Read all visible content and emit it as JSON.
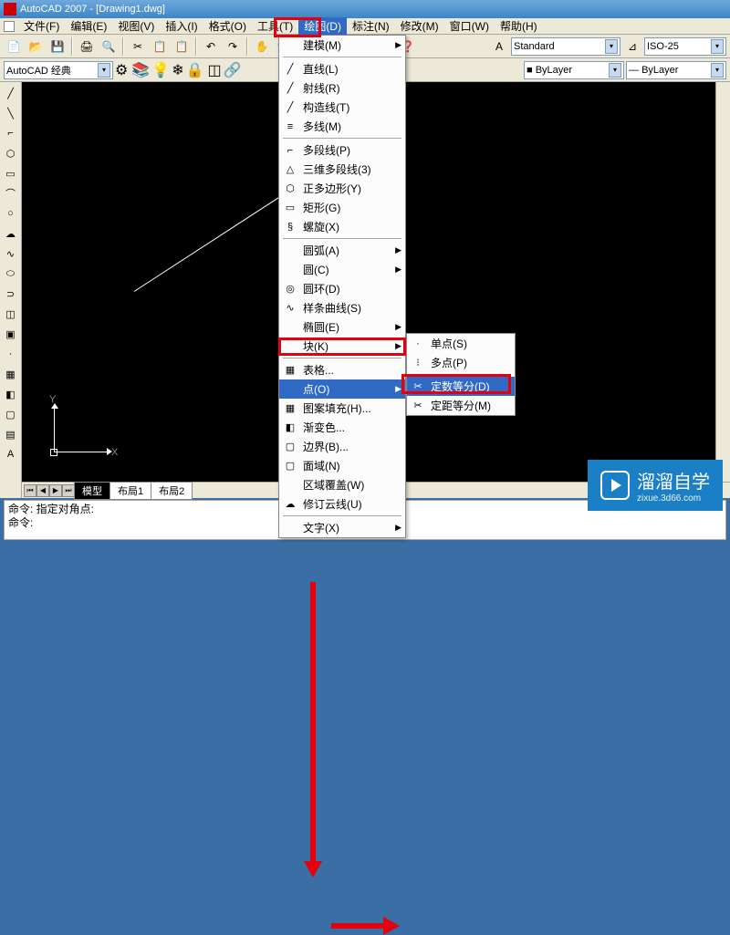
{
  "title": "AutoCAD 2007 - [Drawing1.dwg]",
  "menubar": {
    "file": "文件(F)",
    "edit": "编辑(E)",
    "view": "视图(V)",
    "insert": "插入(I)",
    "format": "格式(O)",
    "tools": "工具(T)",
    "draw": "绘图(D)",
    "dimension": "标注(N)",
    "modify": "修改(M)",
    "window": "窗口(W)",
    "help": "帮助(H)"
  },
  "workspace": "AutoCAD 经典",
  "style_combo": "Standard",
  "dim_combo": "ISO-25",
  "layer_combo": "ByLayer",
  "layer_combo2": "ByLayer",
  "draw_menu": {
    "modeling": "建模(M)",
    "line": "直线(L)",
    "ray": "射线(R)",
    "xline": "构造线(T)",
    "mline": "多线(M)",
    "pline": "多段线(P)",
    "3dpoly": "三维多段线(3)",
    "polygon": "正多边形(Y)",
    "rectangle": "矩形(G)",
    "helix": "螺旋(X)",
    "arc": "圆弧(A)",
    "circle": "圆(C)",
    "donut": "圆环(D)",
    "spline": "样条曲线(S)",
    "ellipse": "椭圆(E)",
    "block": "块(K)",
    "table": "表格...",
    "point": "点(O)",
    "hatch": "图案填充(H)...",
    "gradient": "渐变色...",
    "boundary": "边界(B)...",
    "region": "面域(N)",
    "wipeout": "区域覆盖(W)",
    "revcloud": "修订云线(U)",
    "text": "文字(X)"
  },
  "point_submenu": {
    "single": "单点(S)",
    "multiple": "多点(P)",
    "divide": "定数等分(D)",
    "measure": "定距等分(M)"
  },
  "tabs": {
    "model": "模型",
    "layout1": "布局1",
    "layout2": "布局2"
  },
  "cmdline": {
    "line1": "命令: 指定对角点:",
    "line2": "命令:"
  },
  "ucs": {
    "x": "X",
    "y": "Y"
  },
  "watermark": {
    "brand": "溜溜自学",
    "url": "zixue.3d66.com"
  }
}
